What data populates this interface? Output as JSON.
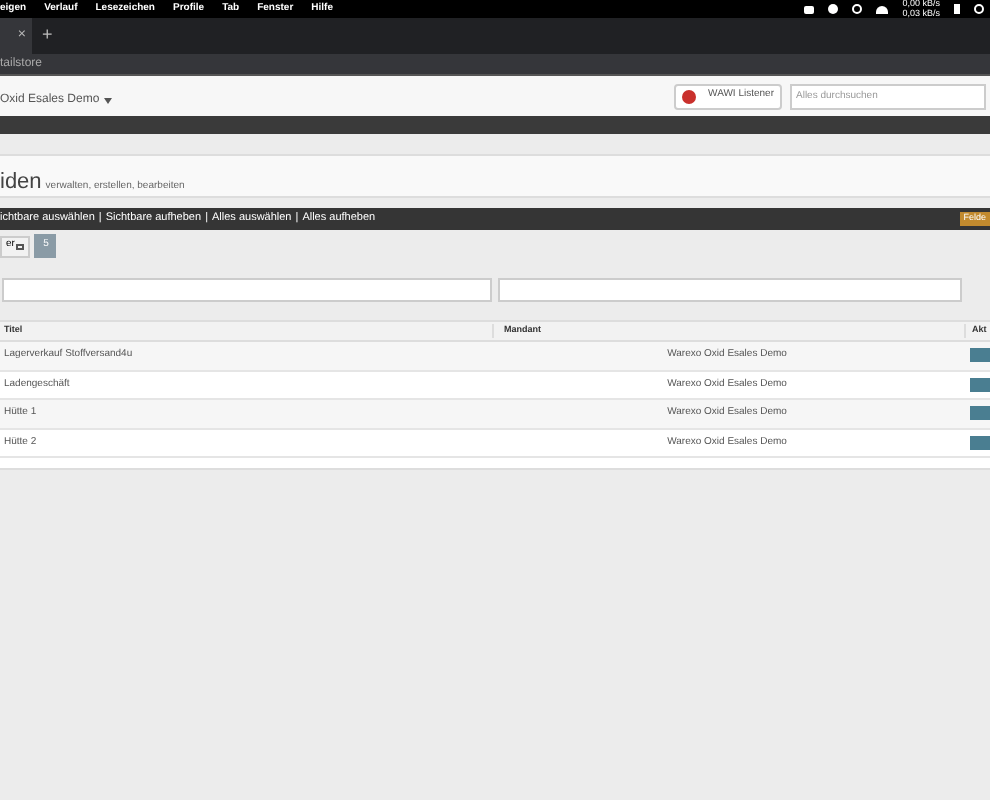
{
  "menu_bar": {
    "items": [
      "eigen",
      "Verlauf",
      "Lesezeichen",
      "Profile",
      "Tab",
      "Fenster",
      "Hilfe"
    ],
    "network": [
      "0,00 kB/s",
      "0,03 kB/s"
    ]
  },
  "browser": {
    "tab_close": "×",
    "new_tab": "+",
    "address": "tailstore"
  },
  "header": {
    "client": "Oxid Esales Demo",
    "listener_button": "WAWI Listener",
    "search": {
      "placeholder": "Alles durchsuchen"
    }
  },
  "page": {
    "title": "iden",
    "subtitle": "verwalten, erstellen, bearbeiten"
  },
  "selection_toolbar": {
    "actions": [
      "ichtbare auswählen",
      "Sichtbare aufheben",
      "Alles auswählen",
      "Alles aufheben"
    ],
    "separators": [
      "|",
      "|",
      "|"
    ],
    "fields_button": "Felde"
  },
  "controls": {
    "columns_button": "er",
    "page_size": "5"
  },
  "table": {
    "columns": [
      "Titel",
      "Mandant",
      "Akt"
    ],
    "rows": [
      {
        "title": "Lagerverkauf Stoffversand4u",
        "client": "Warexo Oxid Esales Demo"
      },
      {
        "title": "Ladengeschäft",
        "client": "Warexo Oxid Esales Demo"
      },
      {
        "title": "Hütte 1",
        "client": "Warexo Oxid Esales Demo"
      },
      {
        "title": "Hütte 2",
        "client": "Warexo Oxid Esales Demo"
      }
    ]
  }
}
